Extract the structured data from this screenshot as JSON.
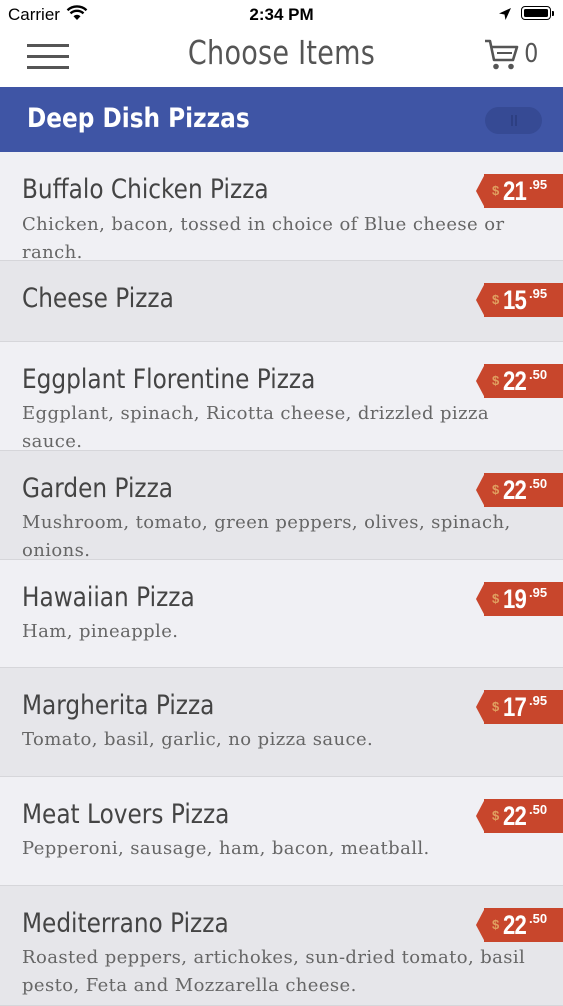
{
  "status_bar": {
    "carrier": "Carrier",
    "time": "2:34 PM"
  },
  "nav": {
    "title": "Choose Items",
    "cart_count": "0"
  },
  "category": {
    "title": "Deep Dish Pizzas"
  },
  "colors": {
    "accent": "#3f55a5",
    "price_tag": "#c8462c"
  },
  "items": [
    {
      "name": "Buffalo Chicken Pizza",
      "description": "Chicken, bacon, tossed in choice of Blue cheese or ranch.",
      "currency": "$",
      "price_dollars": "21",
      "price_cents": ".95"
    },
    {
      "name": "Cheese Pizza",
      "description": "",
      "currency": "$",
      "price_dollars": "15",
      "price_cents": ".95"
    },
    {
      "name": "Eggplant Florentine Pizza",
      "description": "Eggplant, spinach, Ricotta cheese, drizzled pizza sauce.",
      "currency": "$",
      "price_dollars": "22",
      "price_cents": ".50"
    },
    {
      "name": "Garden Pizza",
      "description": "Mushroom, tomato, green peppers, olives, spinach, onions.",
      "currency": "$",
      "price_dollars": "22",
      "price_cents": ".50"
    },
    {
      "name": "Hawaiian Pizza",
      "description": "Ham, pineapple.",
      "currency": "$",
      "price_dollars": "19",
      "price_cents": ".95"
    },
    {
      "name": "Margherita Pizza",
      "description": "Tomato, basil, garlic, no pizza sauce.",
      "currency": "$",
      "price_dollars": "17",
      "price_cents": ".95"
    },
    {
      "name": "Meat Lovers Pizza",
      "description": "Pepperoni, sausage, ham, bacon, meatball.",
      "currency": "$",
      "price_dollars": "22",
      "price_cents": ".50"
    },
    {
      "name": "Mediterrano Pizza",
      "description": "Roasted peppers, artichokes, sun-dried tomato, basil pesto, Feta and Mozzarella cheese.",
      "currency": "$",
      "price_dollars": "22",
      "price_cents": ".50"
    }
  ]
}
